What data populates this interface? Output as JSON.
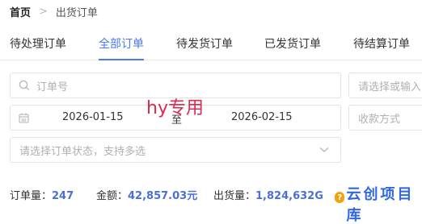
{
  "breadcrumb": {
    "home": "首页",
    "separator": ">",
    "current": "出货订单"
  },
  "tabs": [
    {
      "label": "待处理订单",
      "active": false
    },
    {
      "label": "全部订单",
      "active": true
    },
    {
      "label": "待发货订单",
      "active": false
    },
    {
      "label": "已发货订单",
      "active": false
    },
    {
      "label": "待结算订单",
      "active": false
    }
  ],
  "filters": {
    "order_no_placeholder": "订单号",
    "right_top_placeholder": "请选择或输入",
    "date_start": "2026-01-15",
    "date_separator": "至",
    "date_end": "2026-02-15",
    "payment_placeholder": "收款方式",
    "status_placeholder": "请选择订单状态，支持多选"
  },
  "watermark": "hy专用",
  "stats": {
    "order_count_label": "订单量：",
    "order_count": "247",
    "amount_label": "金额：",
    "amount": "42,857.03元",
    "shipped_label": "出货量：",
    "shipped": "1,824,632G"
  },
  "brand": {
    "badge": "?",
    "text": "云创项目库"
  },
  "colors": {
    "accent": "#4a78f0",
    "stat_value": "#4a6fd6",
    "watermark": "#e0274e",
    "brand": "#2f67e8"
  }
}
